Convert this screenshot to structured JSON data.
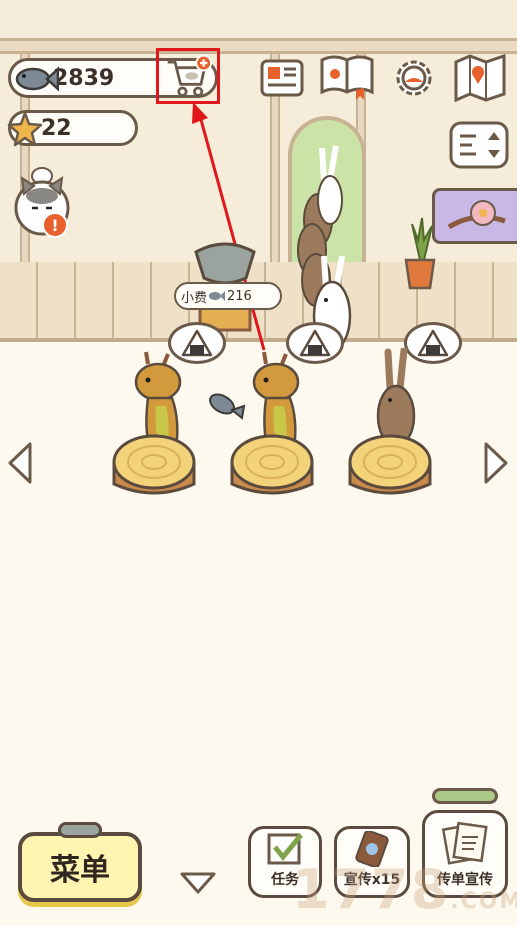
{
  "currency": {
    "fish_count": "2839",
    "star_count": "22"
  },
  "tip_label": "小费",
  "tip_amount": "216",
  "bottom": {
    "menu_label": "菜单",
    "task_label": "任务",
    "promo_label": "宣传x15",
    "flyer_label": "传单宣传"
  },
  "watermark": {
    "main": "1778",
    "sub": ".COM"
  },
  "colors": {
    "highlight": "#e0171b",
    "alert": "#e8612c",
    "menu_button": "#fff4b0"
  }
}
